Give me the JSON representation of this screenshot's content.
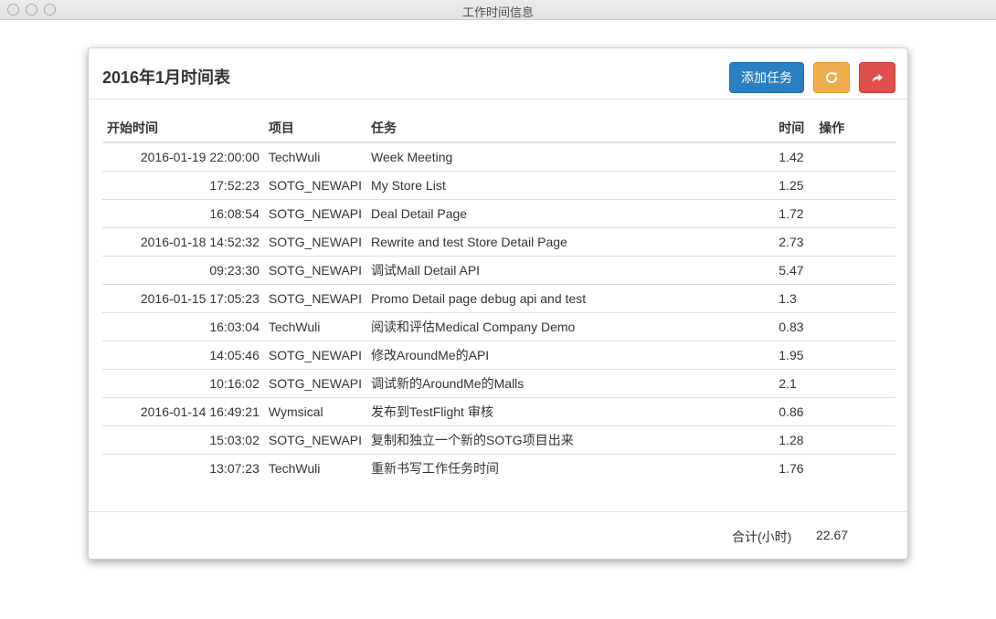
{
  "window": {
    "title": "工作时间信息"
  },
  "panel": {
    "title": "2016年1月时间表",
    "add_label": "添加任务",
    "refresh_icon": "refresh-icon",
    "share_icon": "share-icon"
  },
  "colors": {
    "primary": "#2a7fc3",
    "warning": "#f0ad4e",
    "danger": "#df4f4b"
  },
  "table": {
    "headers": [
      "开始时间",
      "项目",
      "任务",
      "时间",
      "操作"
    ],
    "rows": [
      {
        "start": "2016-01-19 22:00:00",
        "project": "TechWuli",
        "task": "Week Meeting",
        "hours": "1.42"
      },
      {
        "start": "17:52:23",
        "project": "SOTG_NEWAPI",
        "task": "My Store List",
        "hours": "1.25"
      },
      {
        "start": "16:08:54",
        "project": "SOTG_NEWAPI",
        "task": "Deal Detail Page",
        "hours": "1.72"
      },
      {
        "start": "2016-01-18 14:52:32",
        "project": "SOTG_NEWAPI",
        "task": "Rewrite and test Store Detail Page",
        "hours": "2.73"
      },
      {
        "start": "09:23:30",
        "project": "SOTG_NEWAPI",
        "task": "调试Mall Detail API",
        "hours": "5.47"
      },
      {
        "start": "2016-01-15 17:05:23",
        "project": "SOTG_NEWAPI",
        "task": "Promo Detail page debug api and test",
        "hours": "1.3"
      },
      {
        "start": "16:03:04",
        "project": "TechWuli",
        "task": "阅读和评估Medical Company Demo",
        "hours": "0.83"
      },
      {
        "start": "14:05:46",
        "project": "SOTG_NEWAPI",
        "task": "修改AroundMe的API",
        "hours": "1.95"
      },
      {
        "start": "10:16:02",
        "project": "SOTG_NEWAPI",
        "task": "调试新的AroundMe的Malls",
        "hours": "2.1"
      },
      {
        "start": "2016-01-14 16:49:21",
        "project": "Wymsical",
        "task": "发布到TestFlight 审核",
        "hours": "0.86"
      },
      {
        "start": "15:03:02",
        "project": "SOTG_NEWAPI",
        "task": "复制和独立一个新的SOTG项目出来",
        "hours": "1.28"
      },
      {
        "start": "13:07:23",
        "project": "TechWuli",
        "task": "重新书写工作任务时间",
        "hours": "1.76"
      }
    ]
  },
  "footer": {
    "total_label": "合计(小时)",
    "total_value": "22.67"
  }
}
